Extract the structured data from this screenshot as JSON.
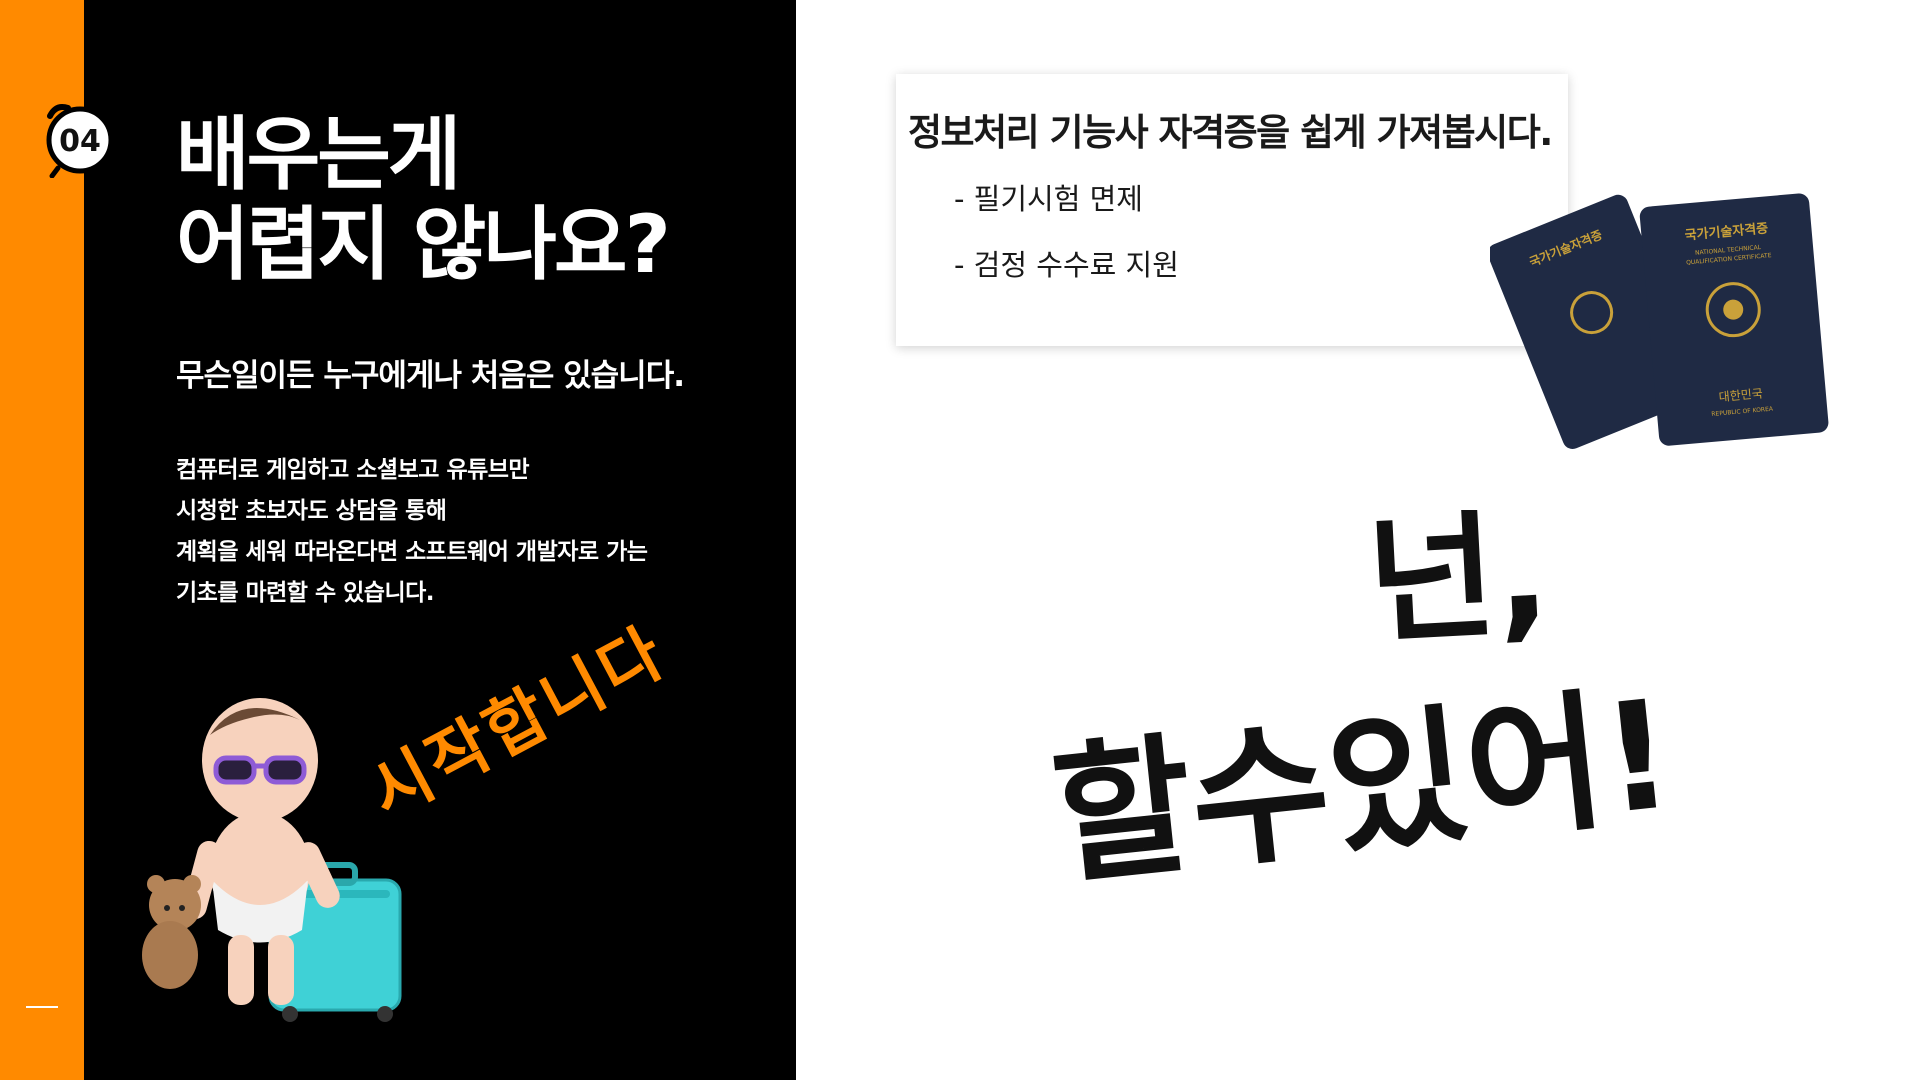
{
  "badge": {
    "number": "04",
    "icon": "alarm-clock-icon"
  },
  "title": {
    "line1": "배우는게",
    "line2": "어렵지 않나요?"
  },
  "subtitle": "무슨일이든 누구에게나 처음은 있습니다.",
  "body": {
    "lines": [
      "컴퓨터로 게임하고 소셜보고 유튜브만",
      "시청한 초보자도 상담을 통해",
      "계획을 세워 따라온다면 소프트웨어 개발자로 가는",
      "기초를 마련할 수 있습니다."
    ]
  },
  "script_text": "시작합니다",
  "card": {
    "title": "정보처리 기능사 자격증을 쉽게 가져봅시다.",
    "items": [
      "- 필기시험 면제",
      "- 검정 수수료 지원"
    ]
  },
  "passport": {
    "title": "국가기술자격증",
    "subtitle1": "NATIONAL TECHNICAL",
    "subtitle2": "QUALIFICATION CERTIFICATE",
    "country": "대한민국",
    "country_en": "REPUBLIC OF KOREA"
  },
  "brush": {
    "line1": "넌,",
    "line2": "할수있어!"
  },
  "colors": {
    "accent": "#ff8a00",
    "panel": "#000000",
    "passport": "#1f2a44",
    "emblem": "#c9a13a"
  }
}
